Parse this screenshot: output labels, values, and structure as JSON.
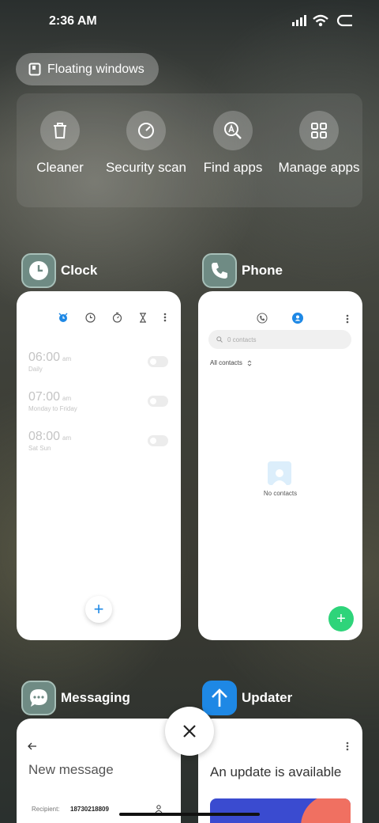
{
  "status_bar": {
    "time": "2:36 AM",
    "icons": [
      "signal-icon",
      "wifi-icon",
      "battery-icon"
    ]
  },
  "floating_windows": {
    "label": "Floating windows",
    "icon": "floating-window-icon"
  },
  "tools": [
    {
      "label": "Cleaner",
      "icon": "trash-icon"
    },
    {
      "label": "Security scan",
      "icon": "security-scan-icon"
    },
    {
      "label": "Find apps",
      "icon": "find-apps-icon"
    },
    {
      "label": "Manage apps",
      "icon": "manage-apps-icon"
    }
  ],
  "recent_apps": [
    {
      "name": "Clock",
      "icon": "clock-icon",
      "alarms": [
        {
          "time": "06:00",
          "period": "am",
          "repeat": "Daily",
          "enabled": false
        },
        {
          "time": "07:00",
          "period": "am",
          "repeat": "Monday to Friday",
          "enabled": false
        },
        {
          "time": "08:00",
          "period": "am",
          "repeat": "Sat Sun",
          "enabled": false
        }
      ],
      "add_button": "+"
    },
    {
      "name": "Phone",
      "icon": "phone-icon",
      "search_placeholder": "0 contacts",
      "filter_label": "All contacts",
      "empty_text": "No contacts",
      "add_button": "+"
    },
    {
      "name": "Messaging",
      "icon": "messaging-icon",
      "title": "New message",
      "recipient_label": "Recipient:",
      "recipient_value": "18730218809"
    },
    {
      "name": "Updater",
      "icon": "updater-icon",
      "title": "An update is available"
    }
  ],
  "colors": {
    "accent_blue": "#1e88e5",
    "phone_fab_green": "#2ed47a",
    "updater_icon_blue": "#1e88e5",
    "update_banner_blue": "#3a4bd0",
    "update_banner_coral": "#f07061"
  }
}
